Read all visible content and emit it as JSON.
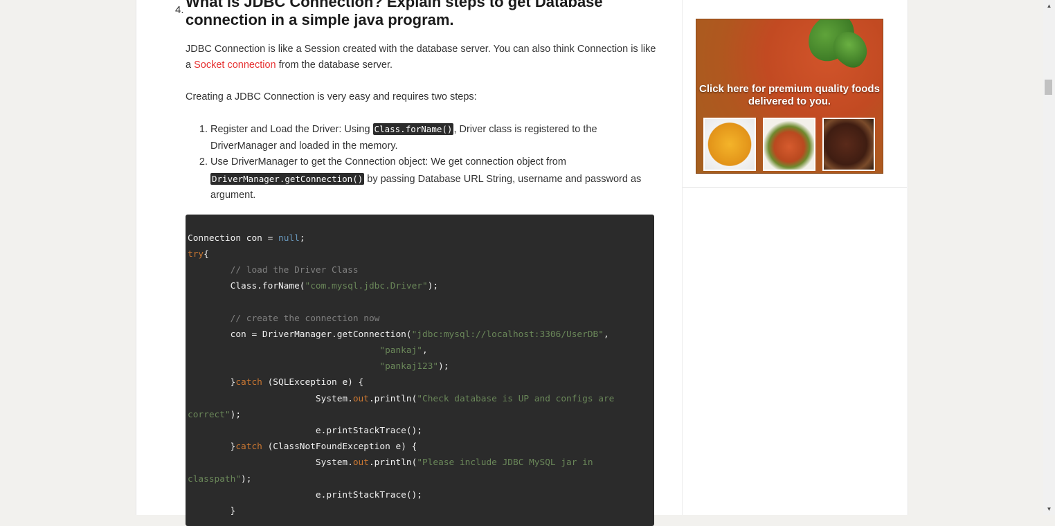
{
  "question": {
    "number": "4.",
    "title": "What is JDBC Connection? Explain steps to get Database connection in a simple java program."
  },
  "intro": {
    "part1": "JDBC Connection is like a Session created with the database server. You can also think Connection is like a ",
    "link": "Socket connection",
    "part2": " from the database server."
  },
  "steps_intro": "Creating a JDBC Connection is very easy and requires two steps:",
  "steps": [
    {
      "pre": "Register and Load the Driver: Using ",
      "code": "Class.forName()",
      "post": ", Driver class is registered to the DriverManager and loaded in the memory."
    },
    {
      "pre": "Use DriverManager to get the Connection object: We get connection object from ",
      "code": "DriverManager.getConnection()",
      "post": " by passing Database URL String, username and password as argument."
    }
  ],
  "code_lines": [
    [
      {
        "t": "Connection con = "
      },
      {
        "t": "null",
        "c": "nl"
      },
      {
        "t": ";"
      }
    ],
    [
      {
        "t": "try",
        "c": "kw"
      },
      {
        "t": "{"
      }
    ],
    [
      {
        "t": "        "
      },
      {
        "t": "// load the Driver Class",
        "c": "cm"
      }
    ],
    [
      {
        "t": "        Class.forName("
      },
      {
        "t": "\"com.mysql.jdbc.Driver\"",
        "c": "st"
      },
      {
        "t": ");"
      }
    ],
    [
      {
        "t": ""
      }
    ],
    [
      {
        "t": "        "
      },
      {
        "t": "// create the connection now",
        "c": "cm"
      }
    ],
    [
      {
        "t": "        con = DriverManager.getConnection("
      },
      {
        "t": "\"jdbc:mysql://localhost:3306/UserDB\"",
        "c": "st"
      },
      {
        "t": ","
      }
    ],
    [
      {
        "t": "                                    "
      },
      {
        "t": "\"pankaj\"",
        "c": "st"
      },
      {
        "t": ","
      }
    ],
    [
      {
        "t": "                                    "
      },
      {
        "t": "\"pankaj123\"",
        "c": "st"
      },
      {
        "t": ");"
      }
    ],
    [
      {
        "t": "        }"
      },
      {
        "t": "catch",
        "c": "kw"
      },
      {
        "t": " (SQLException e) {"
      }
    ],
    [
      {
        "t": "                        System."
      },
      {
        "t": "out",
        "c": "kw"
      },
      {
        "t": ".println("
      },
      {
        "t": "\"Check database is UP and configs are",
        "c": "st"
      }
    ],
    [
      {
        "t": "correct\"",
        "c": "st"
      },
      {
        "t": ");"
      }
    ],
    [
      {
        "t": "                        e.printStackTrace();"
      }
    ],
    [
      {
        "t": "        }"
      },
      {
        "t": "catch",
        "c": "kw"
      },
      {
        "t": " (ClassNotFoundException e) {"
      }
    ],
    [
      {
        "t": "                        System."
      },
      {
        "t": "out",
        "c": "kw"
      },
      {
        "t": ".println("
      },
      {
        "t": "\"Please include JDBC MySQL jar in",
        "c": "st"
      }
    ],
    [
      {
        "t": "classpath\"",
        "c": "st"
      },
      {
        "t": ");"
      }
    ],
    [
      {
        "t": "                        e.printStackTrace();"
      }
    ],
    [
      {
        "t": "        }"
      }
    ]
  ],
  "ad": {
    "text": "Click here for premium quality foods delivered to you."
  },
  "colors": {
    "link": "#e63131",
    "code_bg": "#2b2b2b",
    "keyword": "#cc7832",
    "string": "#6a8759",
    "comment": "#808080",
    "null": "#6897bb"
  },
  "icons": {
    "scroll_up": "triangle-up-icon",
    "scroll_down": "triangle-down-icon"
  }
}
